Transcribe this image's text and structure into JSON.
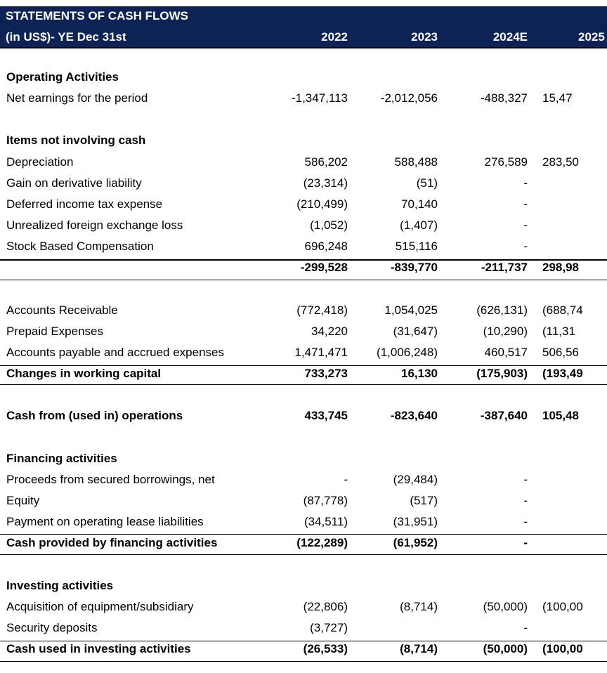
{
  "header": {
    "title": "STATEMENTS OF CASH FLOWS",
    "subtitle": "(in US$)- YE Dec 31st",
    "years": [
      "2022",
      "2023",
      "2024E",
      "2025"
    ]
  },
  "rows": [
    {
      "label": "Operating Activities",
      "bold": true,
      "values": [
        "",
        "",
        "",
        ""
      ]
    },
    {
      "label": "Net earnings for the period",
      "bold": false,
      "values": [
        "-1,347,113",
        "-2,012,056",
        "-488,327",
        "15,47"
      ]
    },
    {
      "label": "Items not involving cash",
      "bold": true,
      "values": [
        "",
        "",
        "",
        ""
      ]
    },
    {
      "label": "Depreciation",
      "bold": false,
      "values": [
        "586,202",
        "588,488",
        "276,589",
        "283,50"
      ]
    },
    {
      "label": "Gain on derivative liability",
      "bold": false,
      "values": [
        "(23,314)",
        "(51)",
        "-",
        ""
      ]
    },
    {
      "label": "Deferred income tax expense",
      "bold": false,
      "values": [
        "(210,499)",
        "70,140",
        "-",
        ""
      ]
    },
    {
      "label": "Unrealized foreign exchange loss",
      "bold": false,
      "values": [
        "(1,052)",
        "(1,407)",
        "-",
        ""
      ]
    },
    {
      "label": "Stock Based Compensation",
      "bold": false,
      "values": [
        "696,248",
        "515,116",
        "-",
        ""
      ]
    },
    {
      "label": "",
      "bold": true,
      "values": [
        "-299,528",
        "-839,770",
        "-211,737",
        "298,98"
      ]
    },
    {
      "label": "Accounts Receivable",
      "bold": false,
      "values": [
        "(772,418)",
        "1,054,025",
        "(626,131)",
        "(688,74"
      ]
    },
    {
      "label": "Prepaid Expenses",
      "bold": false,
      "values": [
        "34,220",
        "(31,647)",
        "(10,290)",
        "(11,31"
      ]
    },
    {
      "label": "Accounts payable and accrued expenses",
      "bold": false,
      "values": [
        "1,471,471",
        "(1,006,248)",
        "460,517",
        "506,56"
      ]
    },
    {
      "label": "Changes in  working capital",
      "bold": true,
      "values": [
        "733,273",
        "16,130",
        "(175,903)",
        "(193,49"
      ]
    },
    {
      "label": "Cash from (used in) operations",
      "bold": true,
      "values": [
        "433,745",
        "-823,640",
        "-387,640",
        "105,48"
      ]
    },
    {
      "label": "Financing activities",
      "bold": true,
      "values": [
        "",
        "",
        "",
        ""
      ]
    },
    {
      "label": "Proceeds from secured borrowings, net",
      "bold": false,
      "values": [
        "-",
        "(29,484)",
        "-",
        ""
      ]
    },
    {
      "label": "Equity",
      "bold": false,
      "values": [
        "(87,778)",
        "(517)",
        "-",
        ""
      ]
    },
    {
      "label": "Payment on operating lease liabilities",
      "bold": false,
      "values": [
        "(34,511)",
        "(31,951)",
        "-",
        ""
      ]
    },
    {
      "label": "Cash provided by financing activities",
      "bold": true,
      "values": [
        "(122,289)",
        "(61,952)",
        "-",
        ""
      ]
    },
    {
      "label": "Investing activities",
      "bold": true,
      "values": [
        "",
        "",
        "",
        ""
      ]
    },
    {
      "label": "Acquisition of equipment/subsidiary",
      "bold": false,
      "values": [
        "(22,806)",
        "(8,714)",
        "(50,000)",
        "(100,00"
      ]
    },
    {
      "label": "Security deposits",
      "bold": false,
      "values": [
        "(3,727)",
        "",
        "-",
        ""
      ]
    },
    {
      "label": "Cash used in investing activities",
      "bold": true,
      "values": [
        "(26,533)",
        "(8,714)",
        "(50,000)",
        "(100,00"
      ]
    }
  ]
}
